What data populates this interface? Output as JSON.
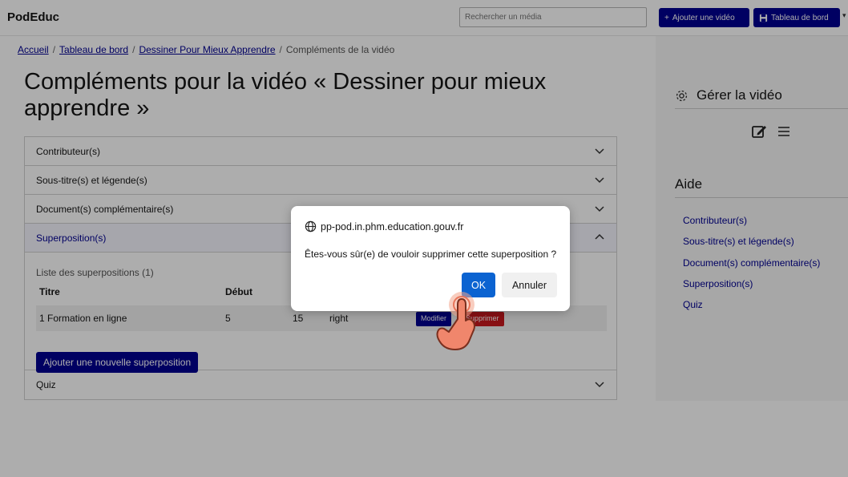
{
  "header": {
    "logo": "PodEduc",
    "search_placeholder": "Rechercher un média",
    "add_video": "Ajouter une vidéo",
    "dashboard": "Tableau de bord"
  },
  "breadcrumb": {
    "home": "Accueil",
    "dashboard": "Tableau de bord",
    "video": "Dessiner Pour Mieux Apprendre",
    "current": "Compléments de la vidéo"
  },
  "page_title": "Compléments pour la vidéo « Dessiner pour mieux apprendre »",
  "accordion": {
    "contributors": "Contributeur(s)",
    "subtitles": "Sous-titre(s) et légende(s)",
    "documents": "Document(s) complémentaire(s)",
    "overlays": "Superposition(s)",
    "quiz": "Quiz"
  },
  "overlays": {
    "list_title": "Liste des superpositions (1)",
    "headers": {
      "title": "Titre",
      "start": "Début"
    },
    "row": {
      "title": "1 Formation en ligne",
      "start": "5",
      "end": "15",
      "position": "right"
    },
    "edit_label": "Modifier",
    "delete_label": "Supprimer",
    "add_new": "Ajouter une nouvelle superposition"
  },
  "sidebar": {
    "manage_title": "Gérer la vidéo",
    "help_title": "Aide",
    "links": {
      "contributors": "Contributeur(s)",
      "subtitles": "Sous-titre(s) et légende(s)",
      "documents": "Document(s) complémentaire(s)",
      "overlays": "Superposition(s)",
      "quiz": "Quiz"
    }
  },
  "dialog": {
    "host": "pp-pod.in.phm.education.gouv.fr",
    "message": "Êtes-vous sûr(e) de vouloir supprimer cette superposition ?",
    "ok": "OK",
    "cancel": "Annuler"
  },
  "colors": {
    "primary": "#000091",
    "danger": "#c9191e",
    "dialog_ok": "#0b63d1"
  }
}
